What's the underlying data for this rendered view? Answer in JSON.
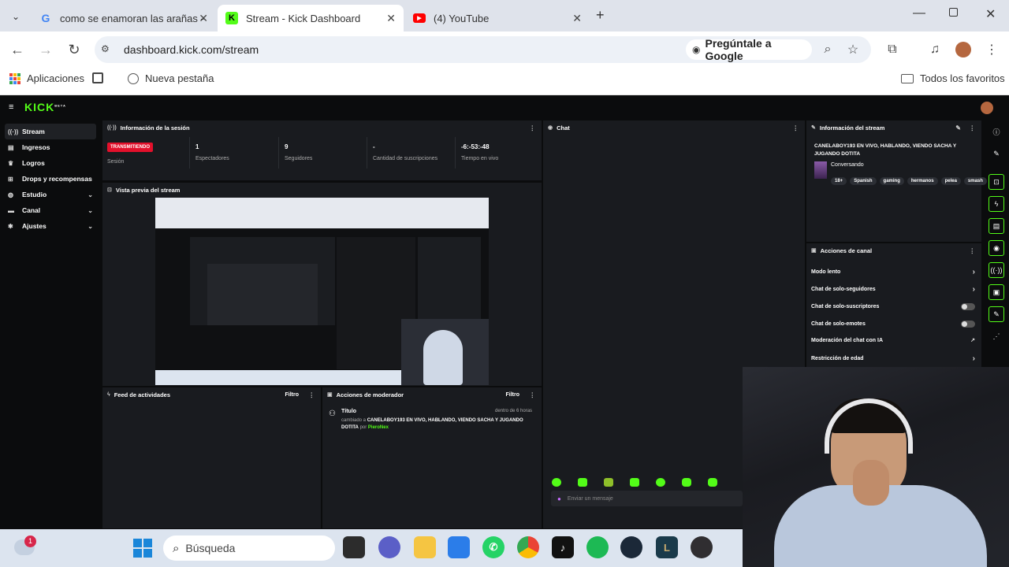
{
  "browser": {
    "tabs": [
      {
        "title": "como se enamoran las arañas -",
        "favicon": "google-icon",
        "active": false
      },
      {
        "title": "Stream - Kick Dashboard",
        "favicon": "kick-icon",
        "active": true
      },
      {
        "title": "(4) YouTube",
        "favicon": "youtube-icon",
        "active": false
      }
    ],
    "new_tab": "+",
    "url": "dashboard.kick.com/stream",
    "lens_label": "Pregúntale a Google",
    "bookmarks": {
      "apps": "Aplicaciones",
      "new_tab": "Nueva pestaña",
      "all": "Todos los favoritos"
    }
  },
  "kick": {
    "logo": "KICK",
    "logo_beta": "BETA",
    "accent": "#53fc18",
    "sidebar": [
      {
        "label": "Stream",
        "icon": "broadcast-icon",
        "active": true
      },
      {
        "label": "Ingresos",
        "icon": "wallet-icon"
      },
      {
        "label": "Logros",
        "icon": "trophy-icon"
      },
      {
        "label": "Drops y recompensas",
        "icon": "gift-icon"
      },
      {
        "label": "Estudio",
        "icon": "studio-icon",
        "chevron": "⌄"
      },
      {
        "label": "Canal",
        "icon": "channel-icon",
        "chevron": "⌄"
      },
      {
        "label": "Ajustes",
        "icon": "gear-icon",
        "chevron": "⌄"
      }
    ],
    "session": {
      "title": "Información de la sesión",
      "badge": "TRANSMITIENDO",
      "badge_label": "Sesión",
      "stats": [
        {
          "value": "1",
          "label": "Espectadores"
        },
        {
          "value": "9",
          "label": "Seguidores"
        },
        {
          "value": "-",
          "label": "Cantidad de suscripciones"
        },
        {
          "value": "-6:-53:-48",
          "label": "Tiempo en vivo"
        }
      ]
    },
    "preview": {
      "title": "Vista previa del stream"
    },
    "chat": {
      "title": "Chat",
      "input_placeholder": "Enviar un mensaje"
    },
    "stream_info": {
      "title": "Información del stream",
      "stream_title": "CANELABOY193 EN VIVO, HABLANDO, VIENDO SACHA Y JUGANDO DOTITA",
      "category": "Conversando",
      "tags": [
        "18+",
        "Spanish",
        "gaming",
        "hermanos",
        "pelea",
        "smash"
      ]
    },
    "channel_actions": {
      "title": "Acciones de canal",
      "items": [
        {
          "label": "Modo lento",
          "control": "›"
        },
        {
          "label": "Chat de solo-seguidores",
          "control": "›"
        },
        {
          "label": "Chat de solo-suscriptores",
          "control": "toggle"
        },
        {
          "label": "Chat de solo-emotes",
          "control": "toggle"
        },
        {
          "label": "Moderación del chat con IA",
          "control": "↗"
        },
        {
          "label": "Restricción de edad",
          "control": "›"
        }
      ]
    },
    "activity": {
      "title": "Feed de actividades",
      "filter": "Filtro"
    },
    "mod": {
      "title": "Acciones de moderador",
      "filter": "Filtro",
      "entry": {
        "heading": "Título",
        "time": "dentro de 6 horas",
        "prefix": "cambiado a",
        "value": "CANELABOY193 EN VIVO, HABLANDO, VIENDO SACHA Y JUGANDO DOTITA",
        "by": "por",
        "user": "PieroNex"
      }
    }
  },
  "taskbar": {
    "search_placeholder": "Búsqueda",
    "weather_badge": "1"
  }
}
